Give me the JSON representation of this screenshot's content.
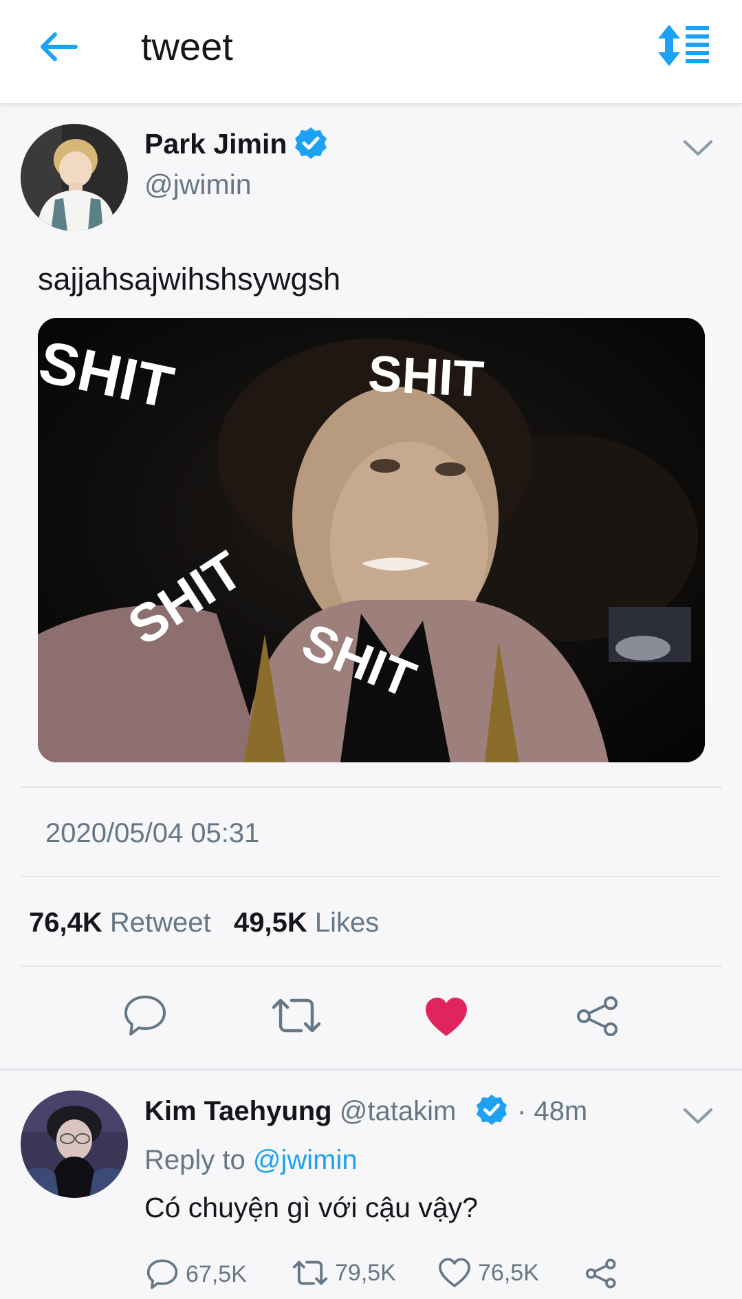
{
  "header": {
    "title": "tweet",
    "back_icon": "arrow-left-icon",
    "sort_icon": "sort-list-icon",
    "accent_color": "#1da1f2"
  },
  "tweet": {
    "author_name": "Park Jimin",
    "author_handle": "@jwimin",
    "verified": true,
    "text": "sajjahsajwihshsywgsh",
    "media_overlay_words": [
      "SHIT",
      "SHIT",
      "SHIT",
      "SHIT"
    ],
    "timestamp": "2020/05/04 05:31",
    "retweet_count": "76,4K",
    "retweet_label": "Retweet",
    "likes_count": "49,5K",
    "likes_label": "Likes",
    "liked": true,
    "like_color": "#e0245e"
  },
  "reply": {
    "author_name": "Kim Taehyung",
    "author_handle": "@tatakim",
    "verified": true,
    "time": "· 48m",
    "reply_to_label": "Reply to",
    "reply_to_handle": "@jwimin",
    "text": "Có chuyện gì với cậu vậy?",
    "reply_count": "67,5K",
    "retweet_count": "79,5K",
    "like_count": "76,5K"
  }
}
